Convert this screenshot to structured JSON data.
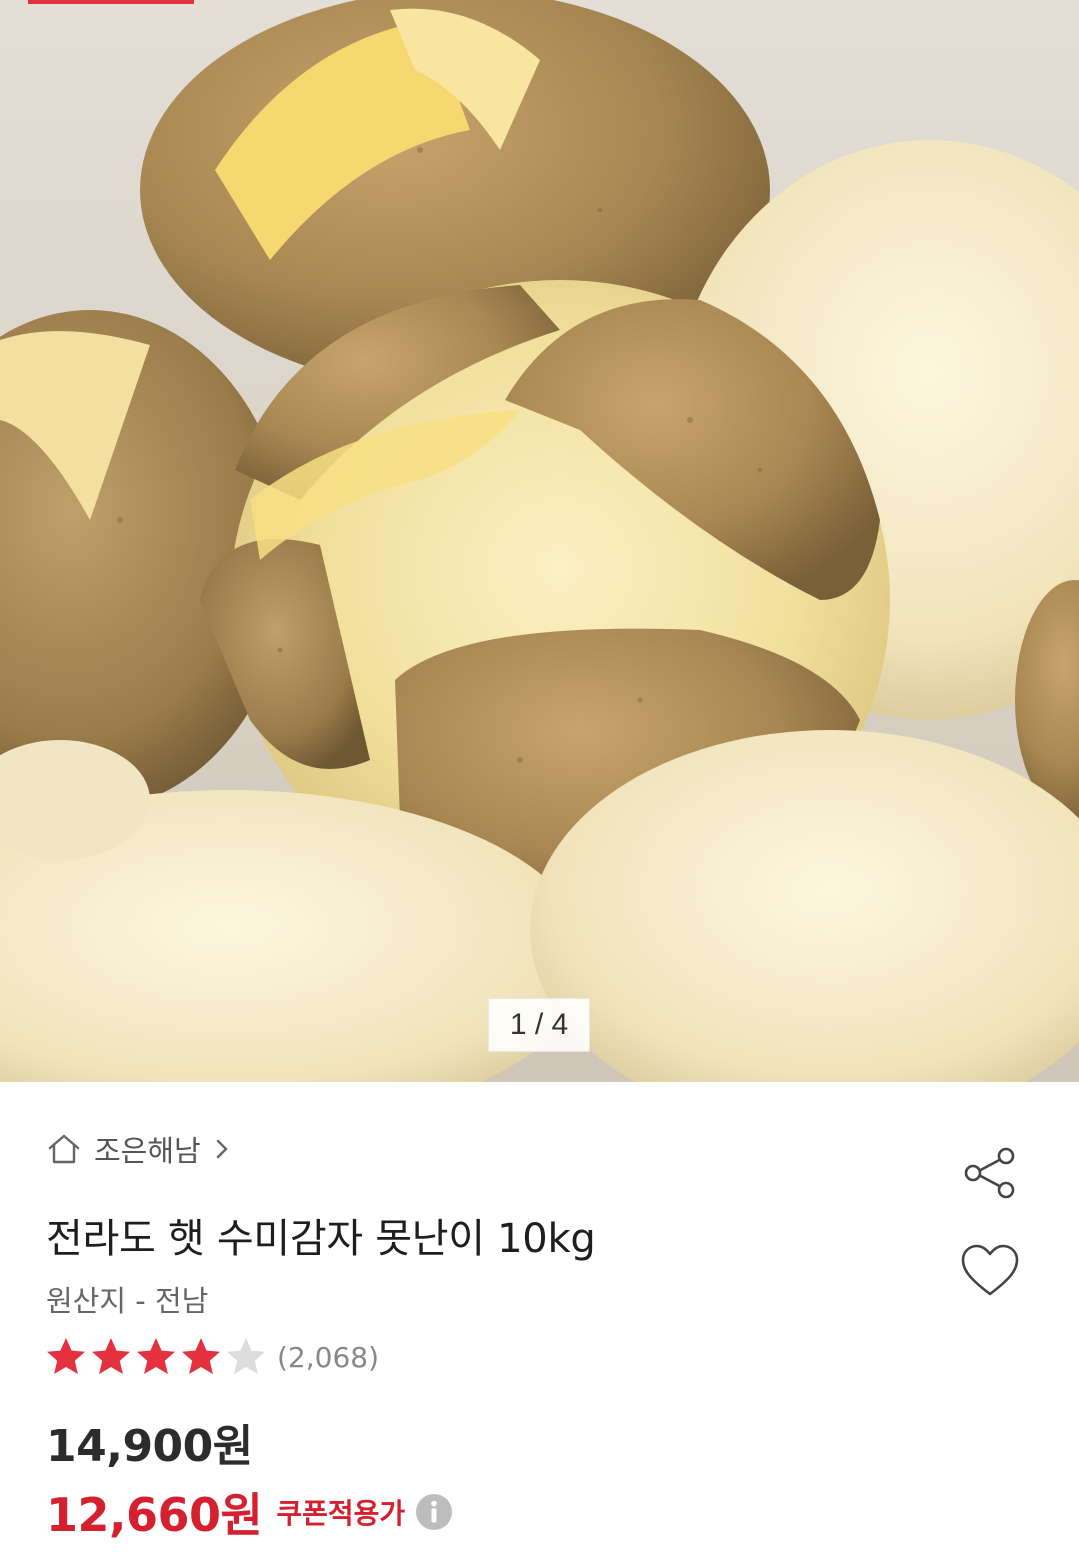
{
  "gallery": {
    "current": "1",
    "total": "4",
    "indicator": "1 / 4"
  },
  "product": {
    "store_name": "조은해남",
    "title": "전라도 햇 수미감자 못난이 10kg",
    "origin": "원산지 - 전남",
    "rating_stars": 4,
    "rating_max": 5,
    "review_count": "(2,068)",
    "price_original": "14,900원",
    "price_coupon": "12,660원",
    "coupon_label": "쿠폰적용가"
  },
  "icons": {
    "home": "home-icon",
    "chevron": "chevron-right-icon",
    "share": "share-icon",
    "wish": "heart-icon",
    "info": "info-icon",
    "star": "star-icon"
  },
  "colors": {
    "accent_red": "#d5202f",
    "star_on": "#e5303e",
    "star_off": "#dddddd",
    "info_icon": "#bdbdbd"
  }
}
